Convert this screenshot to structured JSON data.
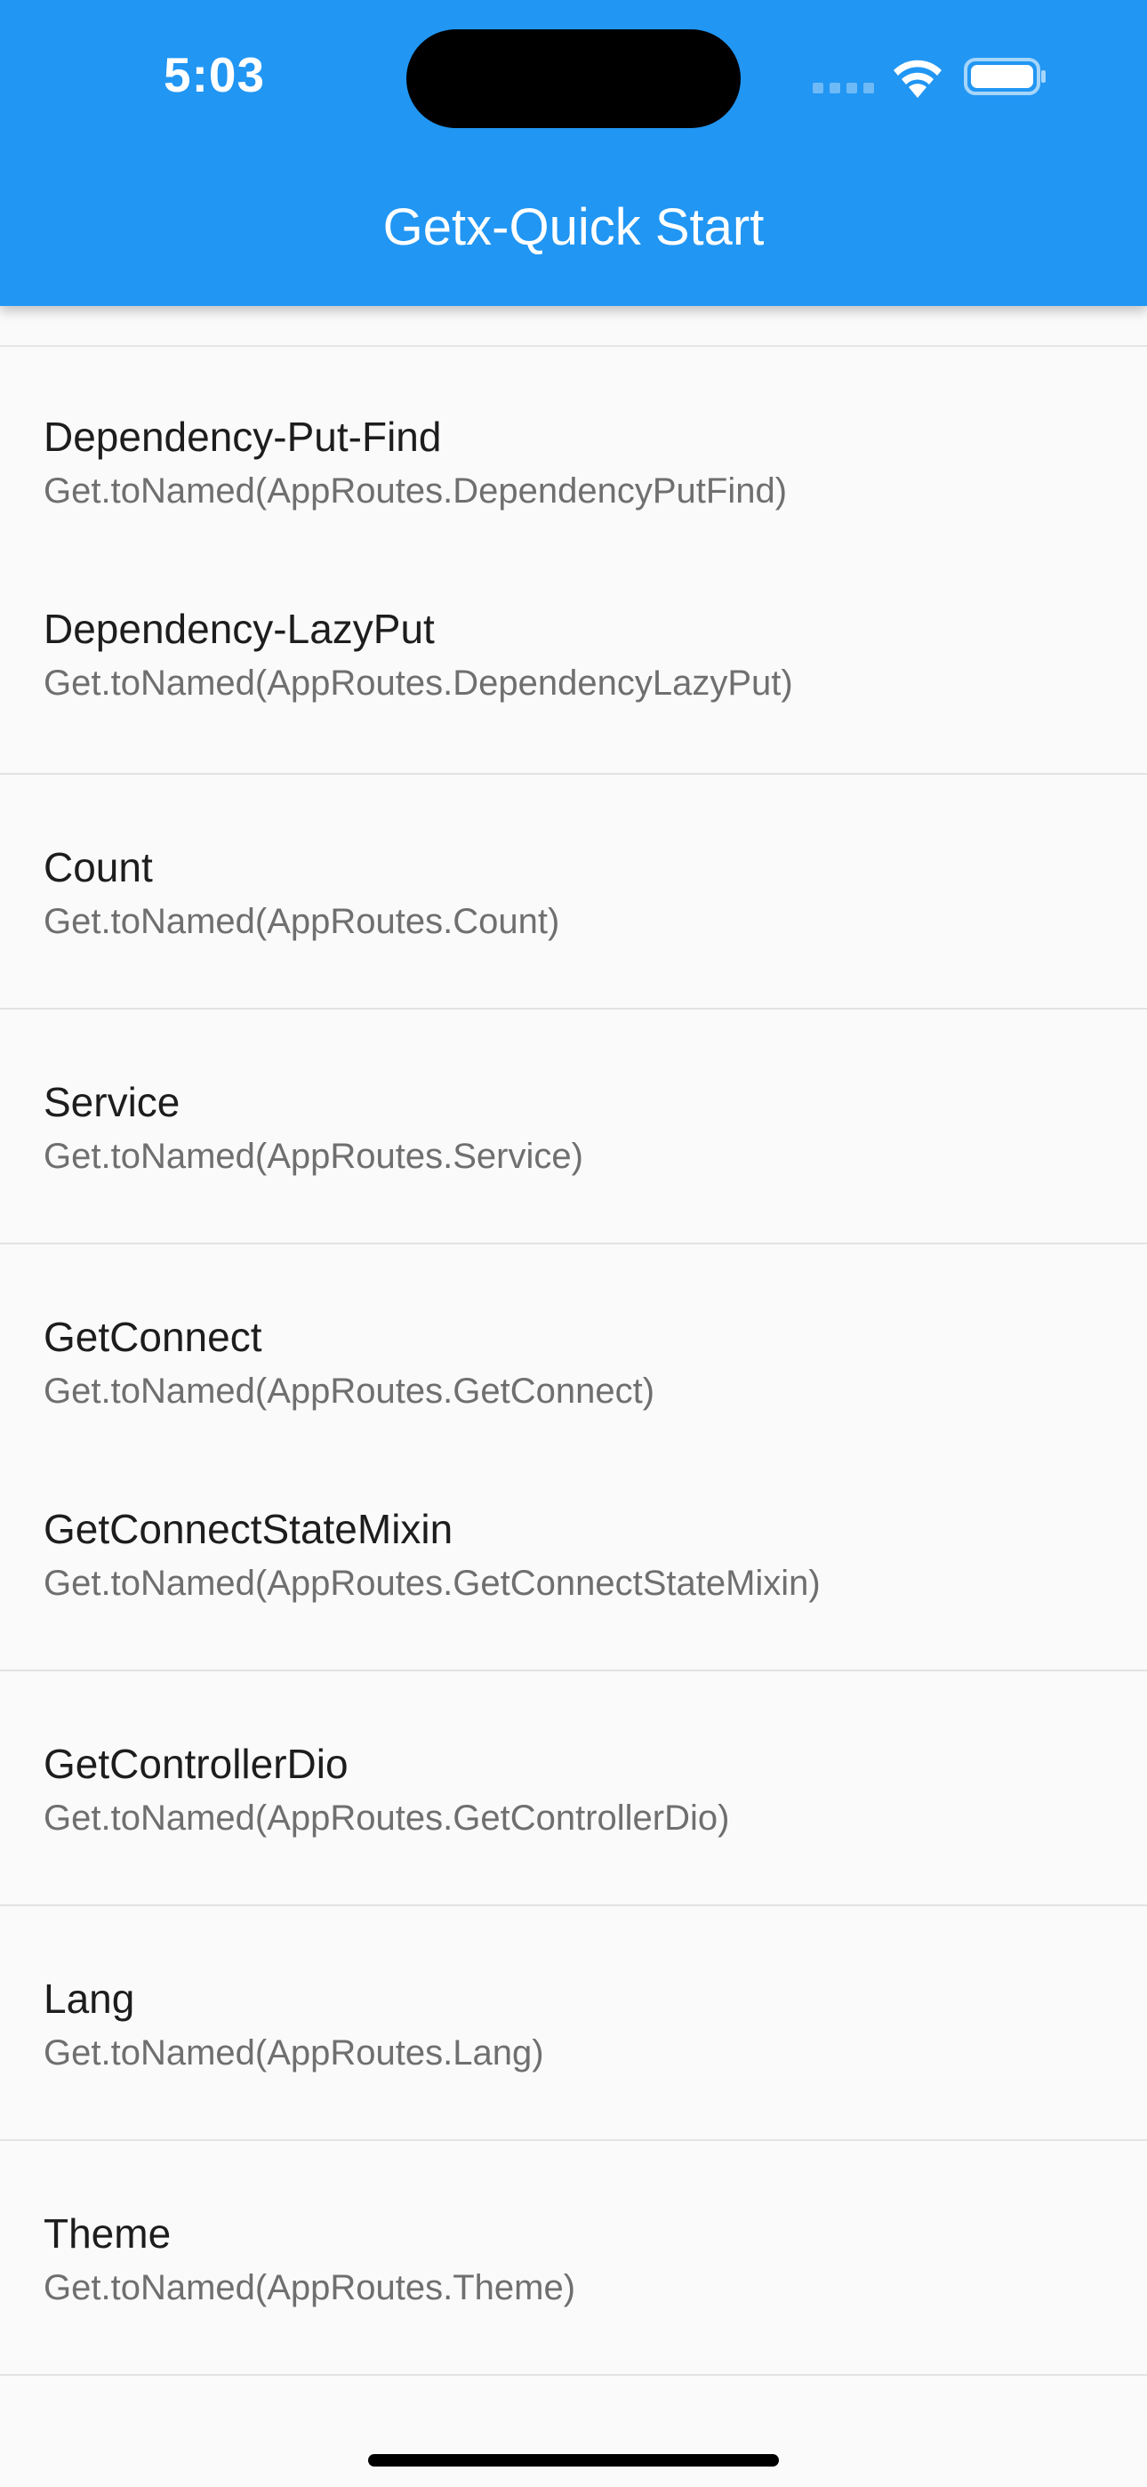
{
  "status_bar": {
    "time": "5:03"
  },
  "appbar": {
    "title": "Getx-Quick Start",
    "background_color": "#2196f3"
  },
  "list": {
    "items": [
      {
        "title": "Dependency-Put-Find",
        "subtitle": "Get.toNamed(AppRoutes.DependencyPutFind)"
      },
      {
        "title": "Dependency-LazyPut",
        "subtitle": "Get.toNamed(AppRoutes.DependencyLazyPut)"
      },
      {
        "title": "Count",
        "subtitle": "Get.toNamed(AppRoutes.Count)"
      },
      {
        "title": "Service",
        "subtitle": "Get.toNamed(AppRoutes.Service)"
      },
      {
        "title": "GetConnect",
        "subtitle": "Get.toNamed(AppRoutes.GetConnect)"
      },
      {
        "title": "GetConnectStateMixin",
        "subtitle": "Get.toNamed(AppRoutes.GetConnectStateMixin)"
      },
      {
        "title": "GetControllerDio",
        "subtitle": "Get.toNamed(AppRoutes.GetControllerDio)"
      },
      {
        "title": "Lang",
        "subtitle": "Get.toNamed(AppRoutes.Lang)"
      },
      {
        "title": "Theme",
        "subtitle": "Get.toNamed(AppRoutes.Theme)"
      }
    ]
  },
  "icons": [
    "wifi-icon",
    "battery-icon",
    "signal-icon"
  ]
}
